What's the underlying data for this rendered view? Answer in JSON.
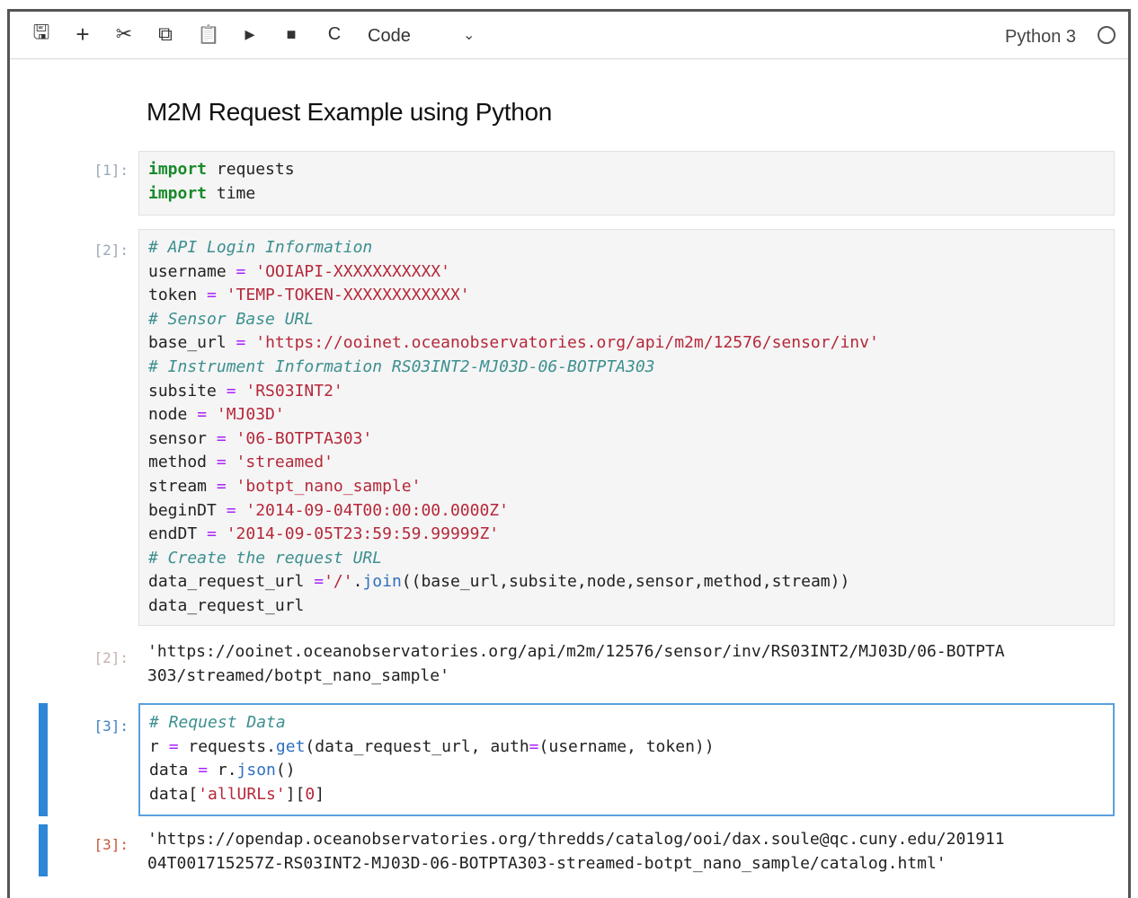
{
  "toolbar": {
    "icons": [
      "save-icon",
      "plus-icon",
      "cut-icon",
      "copy-icon",
      "paste-icon",
      "run-icon",
      "stop-icon",
      "restart-icon"
    ],
    "save_glyph": "🖫",
    "add_glyph": "+",
    "cut_glyph": "✂",
    "copy_glyph": "⧉",
    "paste_glyph": "📋",
    "run_glyph": "▸",
    "stop_glyph": "■",
    "restart_glyph": "C",
    "cell_type": "Code",
    "cell_type_chevron": "⌄",
    "kernel_name": "Python 3"
  },
  "notebook": {
    "title": "M2M Request Example using Python",
    "cells": [
      {
        "prompt": "[1]:"
      },
      {
        "prompt": "[2]:"
      },
      {
        "out_prompt": "[2]:",
        "output_line1": "'https://ooinet.oceanobservatories.org/api/m2m/12576/sensor/inv/RS03INT2/MJ03D/06-BOTPTA",
        "output_line2": "303/streamed/botpt_nano_sample'"
      },
      {
        "prompt": "[3]:"
      },
      {
        "out_prompt": "[3]:",
        "output_line1": "'https://opendap.oceanobservatories.org/thredds/catalog/ooi/dax.soule@qc.cuny.edu/201911",
        "output_line2": "04T001715257Z-RS03INT2-MJ03D-06-BOTPTA303-streamed-botpt_nano_sample/catalog.html'"
      }
    ],
    "code1": {
      "l1_kw": "import",
      "l1_rest": " requests",
      "l2_kw": "import",
      "l2_rest": " time"
    },
    "code2": {
      "c1": "# API Login Information",
      "u_name": "username ",
      "u_op": "=",
      "u_val": " 'OOIAPI-XXXXXXXXXXX'",
      "t_name": "token ",
      "t_op": "=",
      "t_val": " 'TEMP-TOKEN-XXXXXXXXXXXX'",
      "c2": "# Sensor Base URL",
      "b_name": "base_url ",
      "b_op": "=",
      "b_val": " 'https://ooinet.oceanobservatories.org/api/m2m/12576/sensor/inv'",
      "c3": "# Instrument Information RS03INT2-MJ03D-06-BOTPTA303",
      "s_name": "subsite ",
      "s_op": "=",
      "s_val": " 'RS03INT2'",
      "n_name": "node ",
      "n_op": "=",
      "n_val": " 'MJ03D'",
      "se_name": "sensor ",
      "se_op": "=",
      "se_val": " '06-BOTPTA303'",
      "m_name": "method ",
      "m_op": "=",
      "m_val": " 'streamed'",
      "st_name": "stream ",
      "st_op": "=",
      "st_val": " 'botpt_nano_sample'",
      "bd_name": "beginDT ",
      "bd_op": "=",
      "bd_val": " '2014-09-04T00:00:00.0000Z'",
      "ed_name": "endDT ",
      "ed_op": "=",
      "ed_val": " '2014-09-05T23:59:59.99999Z'",
      "c4": "# Create the request URL",
      "dr_name": "data_request_url ",
      "dr_op": "=",
      "dr_str": "'/'",
      "dr_dot": ".",
      "dr_fn": "join",
      "dr_args": "((base_url,subsite,node,sensor,method,stream))",
      "last": "data_request_url"
    },
    "code3": {
      "c1": "# Request Data",
      "r_name": "r ",
      "r_op": "=",
      "r_mid": " requests.",
      "r_fn": "get",
      "r_a": "(data_request_url, auth",
      "r_eq": "=",
      "r_b": "(username, token))",
      "d_name": "data ",
      "d_op": "=",
      "d_mid": " r.",
      "d_fn": "json",
      "d_end": "()",
      "x_a": "data[",
      "x_str": "'allURLs'",
      "x_b": "][",
      "x_num": "0",
      "x_c": "]"
    }
  }
}
